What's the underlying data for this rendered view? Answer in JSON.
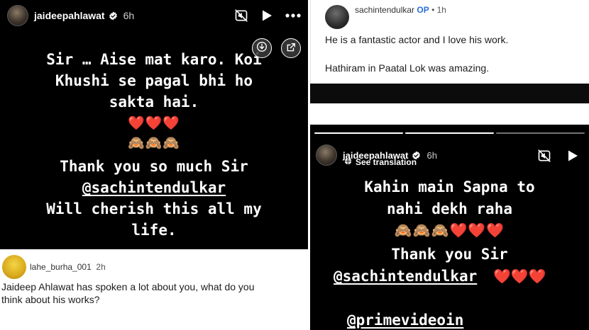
{
  "left_story": {
    "username": "jaideepahlawat",
    "time": "6h",
    "lines": [
      "Sir … Aise mat karo. Koi",
      "Khushi se pagal bhi ho",
      "sakta hai."
    ],
    "emoji_hearts": "❤️❤️❤️",
    "emoji_monkeys": "🙈🙈🙈",
    "thanks": "Thank you so much Sir",
    "mention": "@sachintendulkar",
    "closing_1": "Will cherish this all my",
    "closing_2": "life."
  },
  "left_comment": {
    "username": "lahe_burha_001",
    "time": "2h",
    "text_1": "Jaideep Ahlawat has spoken a lot about you, what do you",
    "text_2": "think about his works?"
  },
  "right_comment": {
    "username": "sachintendulkar",
    "badge": "OP",
    "time": "• 1h",
    "line_1": "He is a fantastic actor and I love his work.",
    "line_2": "Hathiram in Paatal Lok was amazing."
  },
  "right_story": {
    "username": "jaideepahlawat",
    "time": "6h",
    "see_translation": "See translation",
    "line_1": "Kahin main Sapna to",
    "line_2": "nahi dekh raha",
    "emoji_row": "🙈🙈🙈❤️❤️❤️",
    "thanks": "Thank you Sir",
    "mention": "@sachintendulkar",
    "mention_hearts": "❤️❤️❤️",
    "mention_2": "@primevideoin"
  },
  "icons": {
    "verified": "verified-badge-icon",
    "mute": "speaker-muted-icon",
    "play": "play-icon",
    "more": "more-dots-icon",
    "download": "download-icon",
    "share": "external-share-icon",
    "translate": "globe-icon"
  },
  "colors": {
    "story_bg": "#000000",
    "verified_blue": "#3897f0",
    "op_blue": "#2a6fd6"
  }
}
